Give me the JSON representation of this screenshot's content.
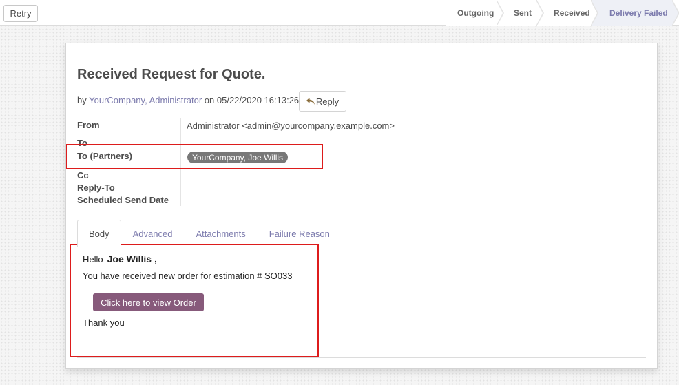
{
  "statusbar": {
    "retry_label": "Retry",
    "stages": [
      "Outgoing",
      "Sent",
      "Received",
      "Delivery Failed"
    ],
    "active_stage": "Delivery Failed"
  },
  "message": {
    "subject": "Received Request for Quote.",
    "by_prefix": "by",
    "author": "YourCompany, Administrator",
    "on_word": "on",
    "date": "05/22/2020 16:13:26",
    "reply_label": "Reply"
  },
  "fields": {
    "from_label": "From",
    "from_value": "Administrator <admin@yourcompany.example.com>",
    "to_label": "To",
    "to_partners_label": "To (Partners)",
    "to_partners_tag": "YourCompany, Joe Willis",
    "cc_label": "Cc",
    "reply_to_label": "Reply-To",
    "scheduled_label": "Scheduled Send Date"
  },
  "tabs": [
    "Body",
    "Advanced",
    "Attachments",
    "Failure Reason"
  ],
  "body": {
    "hello": "Hello",
    "name": "Joe Willis ,",
    "order_line": "You have received new order for estimation # SO033",
    "button_label": "Click here to view Order",
    "thanks": "Thank you"
  },
  "colors": {
    "accent": "#7c7bad",
    "button": "#875a7b",
    "highlight": "#dd1c1c",
    "tag": "#787878"
  }
}
